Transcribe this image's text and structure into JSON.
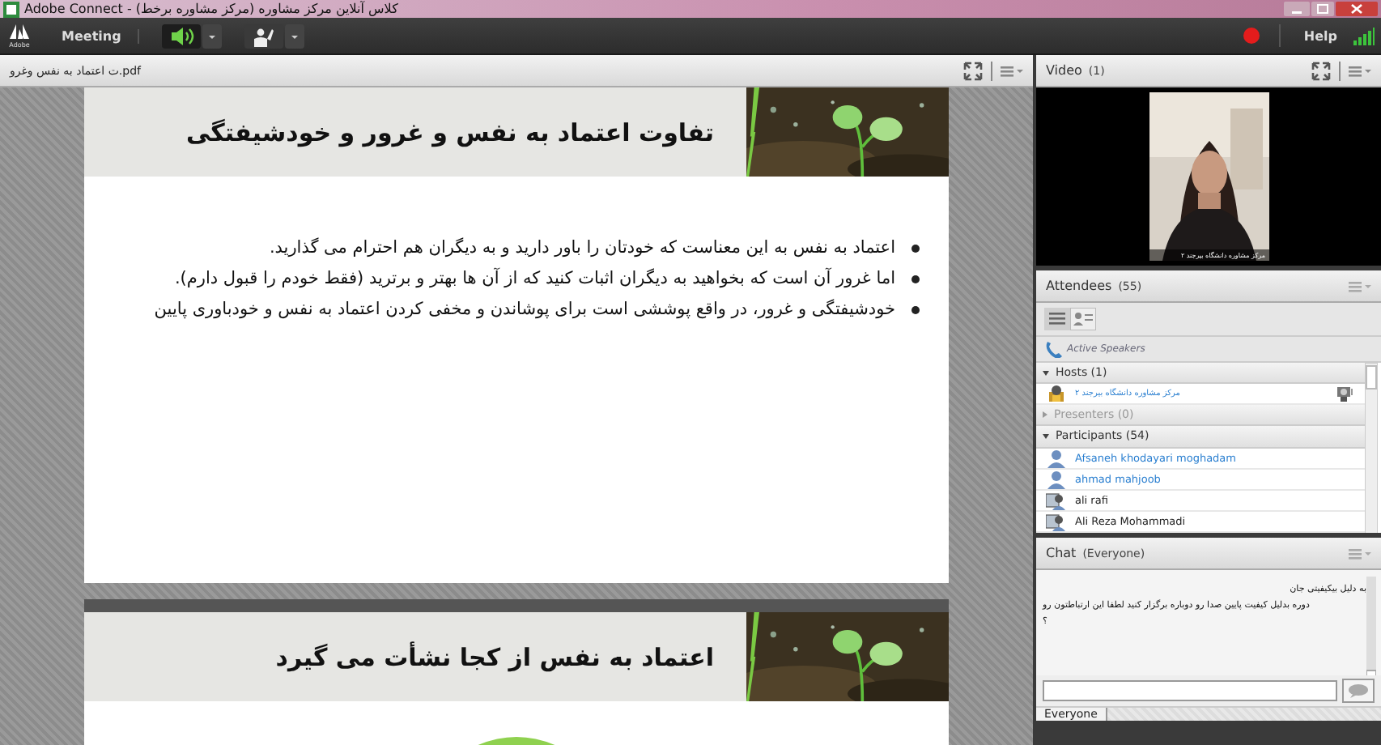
{
  "window": {
    "title": "کلاس آنلاین مرکز مشاوره (مرکز مشاوره برخط) - Adobe Connect"
  },
  "toolbar": {
    "logo": "Adobe",
    "menu": "Meeting",
    "audio_on": true,
    "recording": true,
    "help": "Help"
  },
  "share_pod": {
    "file": "ت اعتماد به نفس وغرو.pdf",
    "slides": [
      {
        "title": "تفاوت اعتماد به نفس و غرور و خودشیفتگی",
        "bullets": [
          "اعتماد به نفس به این معناست که خودتان را باور دارید و به دیگران هم احترام می گذارید.",
          "اما غرور آن است که بخواهید به دیگران اثبات کنید که از آن ها بهتر و برترید (فقط خودم را قبول دارم).",
          "خودشیفتگی و غرور، در واقع پوششی است برای پوشاندن و مخفی کردن اعتماد به نفس و خودباوری پایین"
        ]
      },
      {
        "title": "اعتماد به نفس از کجا نشأت می گیرد"
      }
    ]
  },
  "video_pod": {
    "title": "Video",
    "count": "(1)",
    "caption": "مرکز مشاوره دانشگاه بیرجند ۲"
  },
  "attendees_pod": {
    "title": "Attendees",
    "count": "(55)",
    "active_speakers": "Active Speakers",
    "sections": [
      {
        "label": "Hosts (1)",
        "expanded": true,
        "people": [
          {
            "name": "مرکز مشاوره دانشگاه بیرجند ۲",
            "kind": "host"
          }
        ]
      },
      {
        "label": "Presenters (0)",
        "expanded": false
      },
      {
        "label": "Participants (54)",
        "expanded": true,
        "people": [
          {
            "name": "Afsaneh khodayari moghadam",
            "kind": "registered"
          },
          {
            "name": "ahmad mahjoob",
            "kind": "registered"
          },
          {
            "name": "ali rafi",
            "kind": "guest"
          },
          {
            "name": "Ali Reza Mohammadi",
            "kind": "guest"
          }
        ]
      }
    ]
  },
  "chat_pod": {
    "title": "Chat",
    "scope": "(Everyone)",
    "messages": [
      "به دلیل بیکیفیتی جان",
      "دوره بدلیل کیفیت پایین صدا رو دوباره برگزار کنید لطفا این ارتباطتون رو",
      "؟"
    ],
    "tab": "Everyone"
  }
}
